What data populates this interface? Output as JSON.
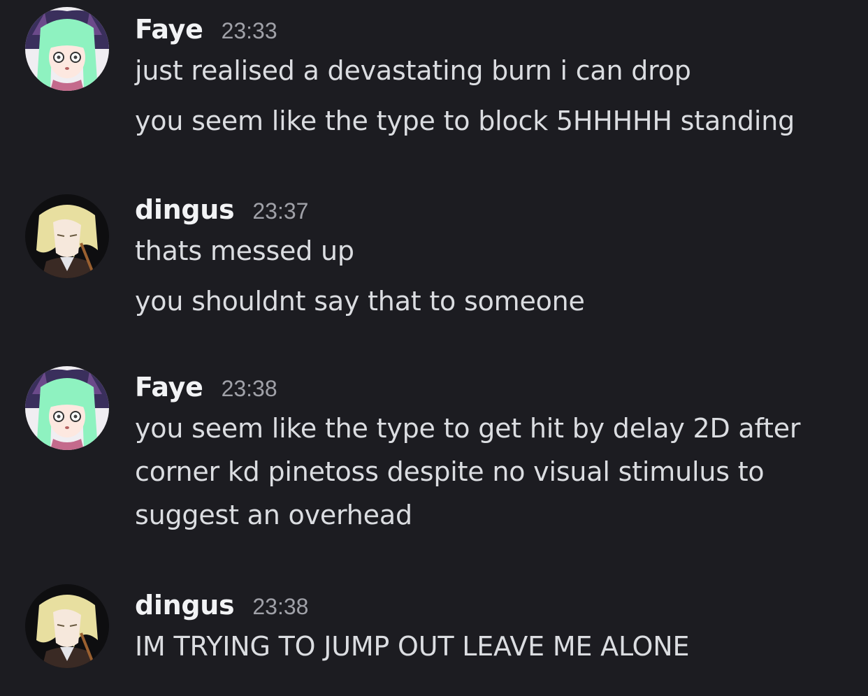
{
  "messages": [
    {
      "author": "Faye",
      "avatar_icon": "green-haired-anime-avatar-icon",
      "time": "23:33",
      "lines": [
        "just realised a devastating burn i can drop",
        "you seem like the type to block 5HHHHH standing"
      ]
    },
    {
      "author": "dingus",
      "avatar_icon": "blonde-anime-avatar-icon",
      "time": "23:37",
      "lines": [
        "thats messed up",
        "you shouldnt say that to someone"
      ]
    },
    {
      "author": "Faye",
      "avatar_icon": "green-haired-anime-avatar-icon",
      "time": "23:38",
      "lines": [
        "you seem like the type to get hit by delay 2D after corner kd pinetoss despite no visual stimulus to suggest an overhead"
      ]
    },
    {
      "author": "dingus",
      "avatar_icon": "blonde-anime-avatar-icon",
      "time": "23:38",
      "lines": [
        "IM TRYING TO JUMP OUT LEAVE ME ALONE"
      ]
    }
  ],
  "colors": {
    "background": "#1c1c21",
    "username": "#f2f3f5",
    "timestamp": "#a0a1a8",
    "message_text": "#dbdde1"
  }
}
